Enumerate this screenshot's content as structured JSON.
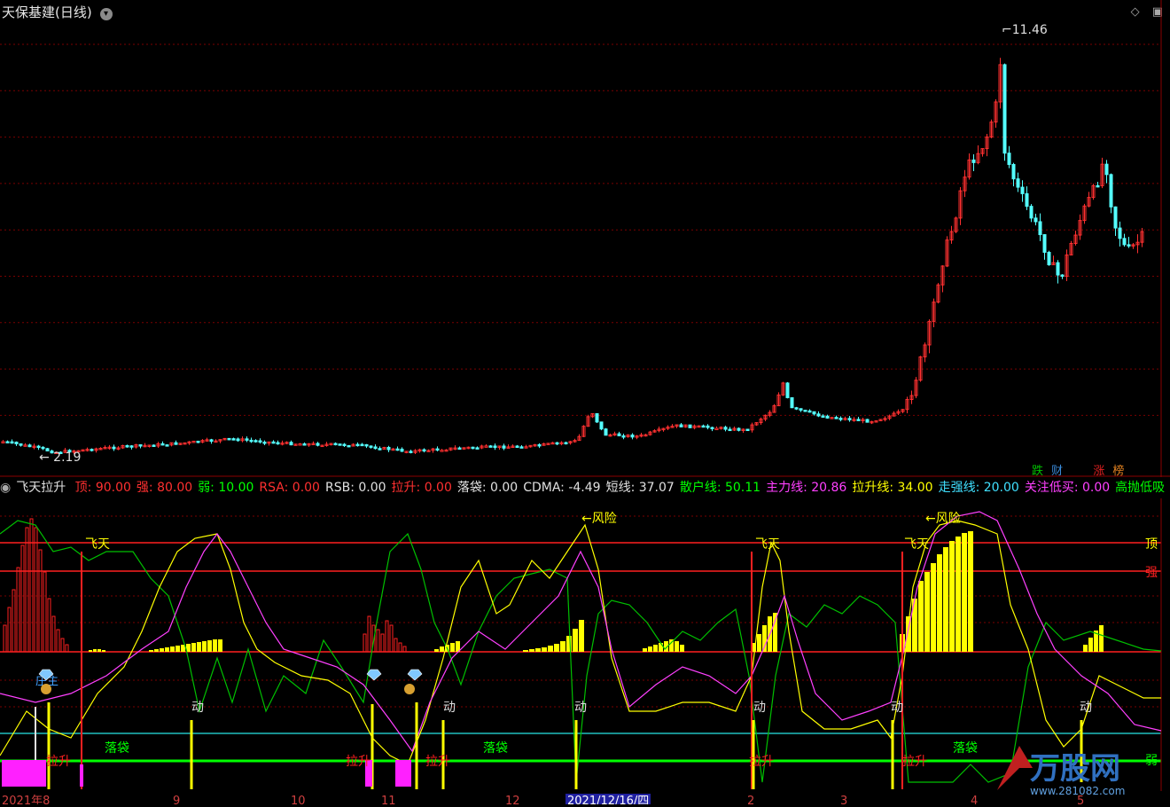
{
  "window": {
    "title": "天保基建(日线)",
    "dropdown_icon": "chevron-down-icon",
    "corner_icons": [
      "diamond-icon",
      "window-restore-icon"
    ]
  },
  "main_chart": {
    "high_label": "11.46",
    "low_label": "2.19",
    "up_color": "#ff3030",
    "down_color": "#54ffff",
    "grid_color": "#8b0000",
    "badges": [
      {
        "text": "跌",
        "color": "#00c000"
      },
      {
        "text": "财",
        "color": "#3a8ad8"
      },
      {
        "text": "涨",
        "color": "#e02020"
      },
      {
        "text": "榜",
        "color": "#e08020"
      }
    ]
  },
  "indicator_panel": {
    "name": "飞天拉升",
    "params": [
      {
        "label": "顶:",
        "value": "90.00",
        "color": "#ff3030"
      },
      {
        "label": "强:",
        "value": "80.00",
        "color": "#ff3030"
      },
      {
        "label": "弱:",
        "value": "10.00",
        "color": "#00ff00"
      },
      {
        "label": "RSA:",
        "value": "0.00",
        "color": "#ff3030"
      },
      {
        "label": "RSB:",
        "value": "0.00",
        "color": "#e0e0e0"
      },
      {
        "label": "拉升:",
        "value": "0.00",
        "color": "#ff3030"
      },
      {
        "label": "落袋:",
        "value": "0.00",
        "color": "#e0e0e0"
      },
      {
        "label": "CDMA:",
        "value": "-4.49",
        "color": "#e0e0e0"
      },
      {
        "label": "短线:",
        "value": "37.07",
        "color": "#e0e0e0"
      },
      {
        "label": "散户线:",
        "value": "50.11",
        "color": "#00ff00"
      },
      {
        "label": "主力线:",
        "value": "20.86",
        "color": "#ff40ff"
      },
      {
        "label": "拉升线:",
        "value": "34.00",
        "color": "#ffff00"
      },
      {
        "label": "走强线:",
        "value": "20.00",
        "color": "#40e0ff"
      },
      {
        "label": "关注低买:",
        "value": "0.00",
        "color": "#ff40ff"
      },
      {
        "label": "高抛低吸",
        "value": "",
        "color": "#00ff00"
      }
    ],
    "right_labels": {
      "top": "顶",
      "strong": "强",
      "weak": "弱"
    },
    "annotations": {
      "fly": "飞天",
      "risk": "←风险",
      "move": "动",
      "bag": "落袋",
      "lift": "拉升",
      "main": "庄主"
    }
  },
  "date_axis": {
    "labels": [
      "2021年8",
      "9",
      "10",
      "11",
      "12",
      "2021/12/16/四",
      "2",
      "3",
      "4",
      "5"
    ]
  },
  "watermark": {
    "brand": "万股网",
    "url": "www.281082.com"
  }
}
